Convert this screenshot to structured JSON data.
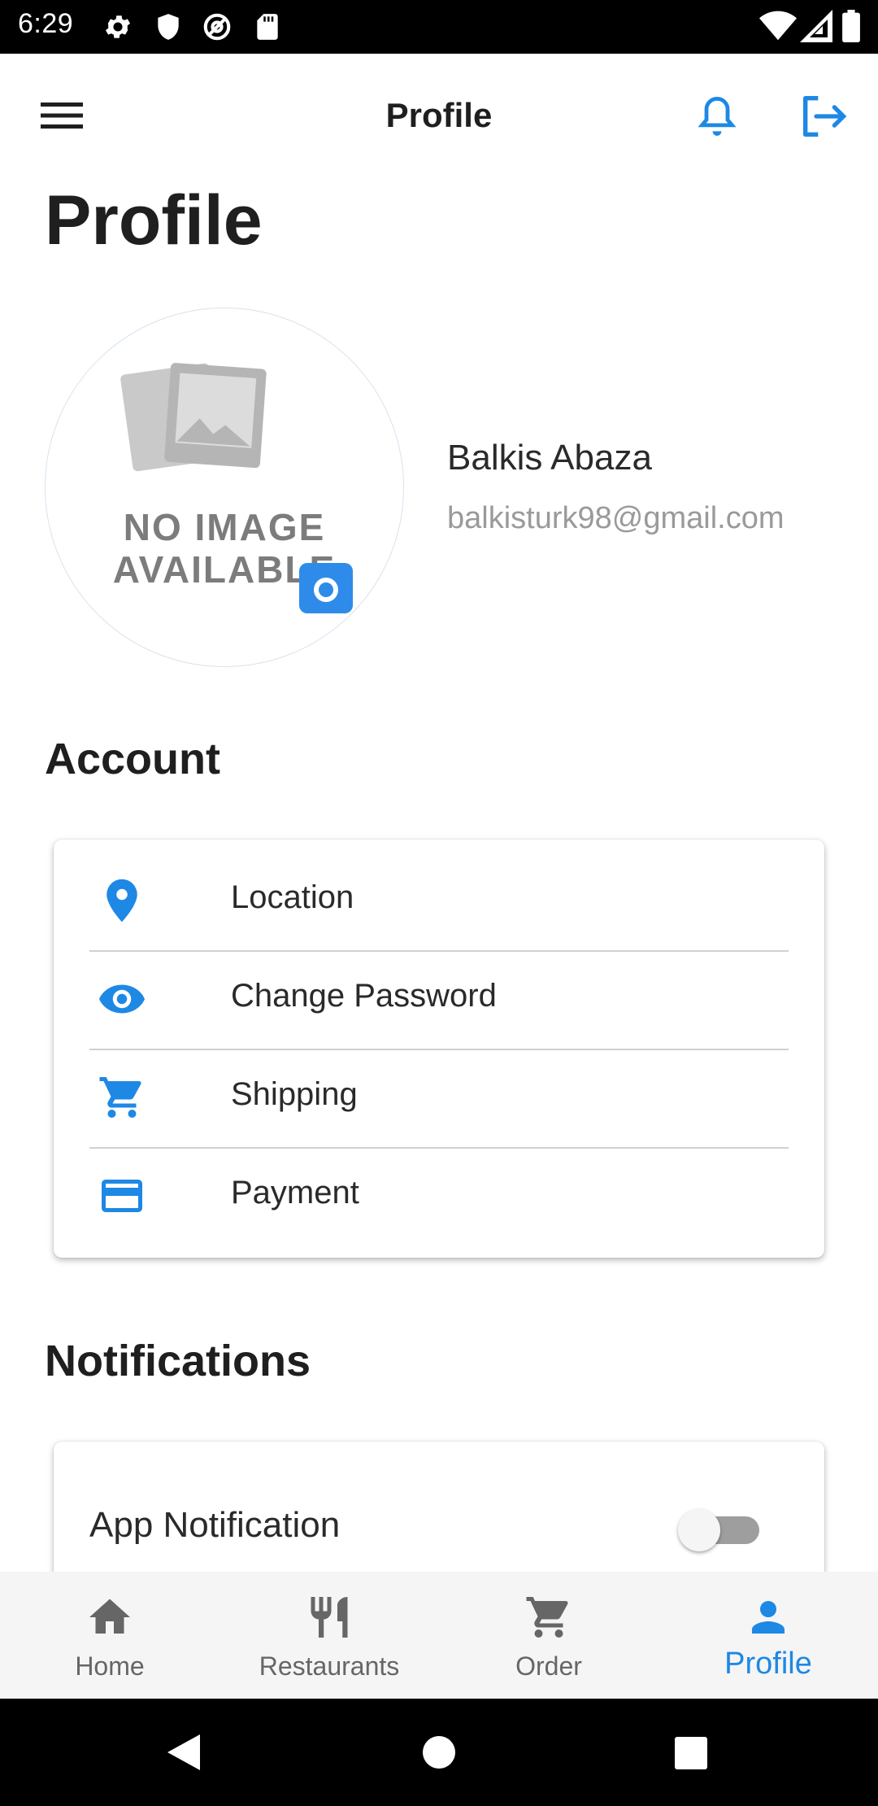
{
  "status_bar": {
    "time": "6:29",
    "left_icons": [
      "settings-gear-icon",
      "shield-icon",
      "at-sign-icon",
      "sd-card-icon"
    ],
    "right_icons": [
      "wifi-icon",
      "cellular-signal-icon",
      "battery-icon"
    ]
  },
  "app_bar": {
    "title": "Profile",
    "menu_icon": "hamburger-menu-icon",
    "actions": [
      "bell-icon",
      "logout-icon"
    ],
    "accent_color": "#1e88e5"
  },
  "page": {
    "heading": "Profile"
  },
  "profile": {
    "placeholder_line1": "NO IMAGE",
    "placeholder_line2": "AVAILABLE",
    "name": "Balkis Abaza",
    "email": "balkisturk98@gmail.com",
    "camera_icon": "camera-icon"
  },
  "account": {
    "title": "Account",
    "items": [
      {
        "label": "Location",
        "icon": "location-pin-icon"
      },
      {
        "label": "Change Password",
        "icon": "eye-icon"
      },
      {
        "label": "Shipping",
        "icon": "cart-icon"
      },
      {
        "label": "Payment",
        "icon": "credit-card-icon"
      }
    ]
  },
  "notifications": {
    "title": "Notifications",
    "app_notification_label": "App Notification",
    "app_notification_enabled": false
  },
  "bottom_nav": {
    "items": [
      {
        "label": "Home",
        "icon": "home-icon",
        "active": false
      },
      {
        "label": "Restaurants",
        "icon": "fork-knife-icon",
        "active": false
      },
      {
        "label": "Order",
        "icon": "cart-icon",
        "active": false
      },
      {
        "label": "Profile",
        "icon": "person-icon",
        "active": true
      }
    ]
  },
  "system_nav": [
    "back-icon",
    "home-circle-icon",
    "recents-icon"
  ]
}
